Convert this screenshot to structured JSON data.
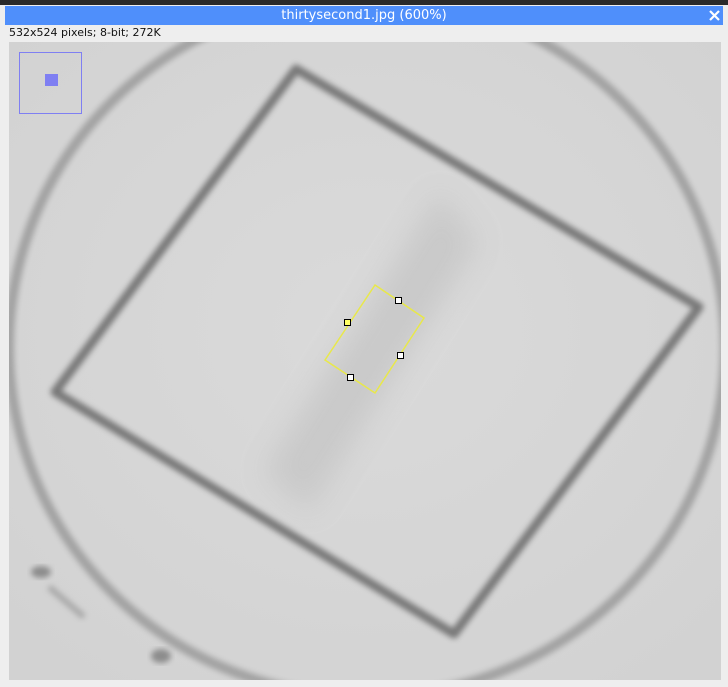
{
  "window": {
    "title": "thirtysecond1.jpg (600%)",
    "info": "532x524 pixels; 8-bit; 272K"
  },
  "colors": {
    "titlebar": "#4f8ffb",
    "canvas_background": "#d7d7d7",
    "selection_outline": "#e8e84a",
    "navigator": "#7f7ff2"
  },
  "icons": {
    "close": "close-icon"
  },
  "image_view": {
    "zoom": "600%",
    "selection_type": "rotated-rectangle"
  }
}
